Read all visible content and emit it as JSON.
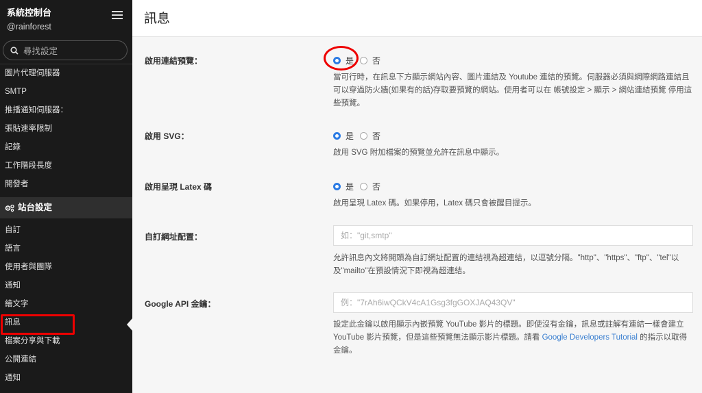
{
  "sidebar": {
    "title": "系統控制台",
    "user": "@rainforest",
    "search_placeholder": "尋找設定",
    "items_top": [
      "圖片代理伺服器",
      "SMTP",
      "推播通知伺服器：",
      "張貼速率限制",
      "記錄",
      "工作階段長度",
      "開發者"
    ],
    "section_label": "站台設定",
    "items_bottom": [
      "自訂",
      "語言",
      "使用者與團隊",
      "通知",
      "繪文字",
      "訊息",
      "檔案分享與下載",
      "公開連結",
      "通知"
    ]
  },
  "page": {
    "title": "訊息"
  },
  "settings": {
    "link_preview": {
      "label": "啟用連結預覽：",
      "yes": "是",
      "no": "否",
      "desc": "當可行時，在訊息下方顯示網站內容、圖片連結及 Youtube 連結的預覽。伺服器必須與網際網路連結且可以穿過防火牆(如果有的話)存取要預覽的網站。使用者可以在 帳號設定 > 顯示 > 網站連結預覽 停用這些預覽。"
    },
    "svg": {
      "label": "啟用 SVG：",
      "yes": "是",
      "no": "否",
      "desc": "啟用 SVG 附加檔案的預覽並允許在訊息中顯示。"
    },
    "latex": {
      "label": "啟用呈現 Latex 碼",
      "yes": "是",
      "no": "否",
      "desc": "啟用呈現 Latex 碼。如果停用，Latex 碼只會被醒目提示。"
    },
    "custom_url": {
      "label": "自訂網址配置：",
      "placeholder": "如：\"git,smtp\"",
      "desc": "允許訊息內文將開頭為自訂網址配置的連結視為超連結，以逗號分隔。\"http\"、\"https\"、\"ftp\"、\"tel\"以及\"mailto\"在預設情況下即視為超連結。"
    },
    "google_api": {
      "label": "Google API 金鑰：",
      "placeholder": "例：\"7rAh6iwQCkV4cA1Gsg3fgGOXJAQ43QV\"",
      "desc_before": "設定此金鑰以啟用顯示內嵌預覽 YouTube 影片的標題。即使沒有金鑰，訊息或註解有連結一樣會建立 YouTube 影片預覽，但是這些預覽無法顯示影片標題。請看 ",
      "link_text": "Google Developers Tutorial",
      "desc_after": " 的指示以取得金鑰。"
    }
  },
  "colors": {
    "accent": "#2b7be4",
    "annotation": "#ee0000",
    "sidebar_bg": "#1a1a1a"
  }
}
